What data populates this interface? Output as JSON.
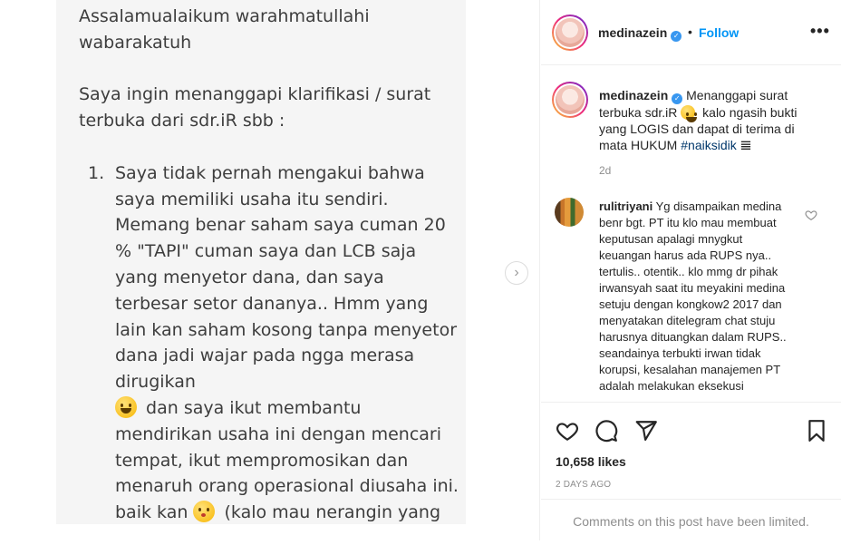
{
  "media": {
    "greeting": "Assalamualaikum warahmatullahi wabarakatuh",
    "intro": "Saya ingin menanggapi klarifikasi / surat terbuka dari sdr.iR sbb :",
    "list": {
      "number": "1.",
      "part1": "Saya tidak pernah mengakui bahwa saya memiliki usaha itu sendiri. Memang benar saham saya cuman 20 % \"TAPI\" cuman saya dan LCB saja yang menyetor dana, dan saya terbesar setor dananya.. Hmm yang lain kan saham kosong tanpa menyetor dana jadi wajar pada ngga merasa dirugikan",
      "part2": "dan saya ikut membantu mendirikan usaha ini dengan mencari tempat, ikut mempromosikan dan menaruh orang operasional diusaha ini. baik kan",
      "part3": "(kalo mau nerangin yang jelas sekalian mas)."
    },
    "next_button": "›"
  },
  "header": {
    "username": "medinazein",
    "verified": "✓",
    "separator": "•",
    "follow_label": "Follow",
    "more_label": "•••"
  },
  "caption": {
    "username": "medinazein",
    "verified": "✓",
    "text_before_emoji": "Menanggapi surat terbuka sdr.iR",
    "text_after_emoji": "kalo ngasih bukti yang LOGIS dan dapat di terima di mata HUKUM",
    "hashtag": "#naiksidik",
    "trailing_symbol": "𝌆",
    "time": "2d"
  },
  "comment": {
    "username": "rulitriyani",
    "text": "Yg disampaikan medina benr bgt. PT itu klo mau membuat keputusan apalagi mnygkut keuangan harus ada RUPS nya.. tertulis.. otentik.. klo mmg dr pihak irwansyah saat itu meyakini medina setuju dengan kongkow2 2017 dan menyatakan ditelegram chat stuju harusnya dituangkan dalam RUPS.. seandainya terbukti irwan tidak korupsi, kesalahan manajemen PT adalah melakukan eksekusi"
  },
  "actions": {
    "likes": "10,658 likes",
    "date": "2 DAYS AGO",
    "comments_limited": "Comments on this post have been limited."
  },
  "colors": {
    "accent": "#0095f6",
    "hashtag": "#00376b",
    "muted": "#8e8e8e",
    "text": "#262626"
  }
}
